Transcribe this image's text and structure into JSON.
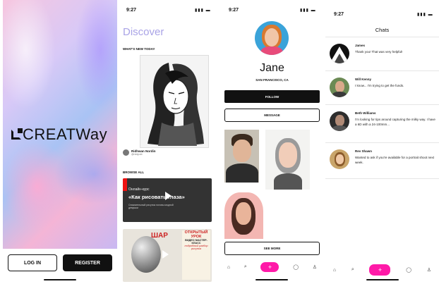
{
  "panel1": {
    "logo_text": "CREATWay",
    "login_label": "LOG IN",
    "register_label": "REGISTER"
  },
  "panel2": {
    "time": "9:27",
    "title": "Discover",
    "whats_new_label": "WHAT'S NEW TODAY",
    "author_name": "Ridhwan Nordin",
    "author_handle": "@ridzjcob",
    "browse_label": "BROWSE ALL",
    "card1": {
      "line1": "Онлайн-курс",
      "line2": "«Как рисовать глаза»",
      "line3": "Снимательный рисунок головы модной девушки"
    },
    "card2": {
      "shar": "ШАР",
      "side_title": "ОТКРЫТЫЙ УРОК",
      "side_sub": "ВИДЕО МАСТЕР-КЛАСС",
      "side_italic": "подробный разбор рисунка"
    }
  },
  "panel3": {
    "time": "9:27",
    "name": "Jane",
    "location": "SAN FRANCISCO, CA",
    "follow_label": "FOLLOW",
    "message_label": "MESSAGE",
    "see_more_label": "SEE MORE",
    "tabs": [
      "home-icon",
      "search-icon",
      "plus-icon",
      "chat-icon",
      "profile-icon"
    ]
  },
  "panel4": {
    "time": "9:27",
    "title": "Chats",
    "chats": [
      {
        "name": "James",
        "message": "Thank you! That was very helpful!"
      },
      {
        "name": "Will Kenny",
        "message": "I know... I'm trying to get the funds."
      },
      {
        "name": "Beth Williams",
        "message": "I'm looking for tips around capturing the milky way. I have a 6D with a 24-100mm..."
      },
      {
        "name": "Rev Shawn",
        "message": "Wanted to ask if you're available for a portrait shoot next week."
      }
    ]
  },
  "colors": {
    "accent_pink": "#ff1aa8",
    "discover_lavender": "#a9a3e6",
    "dark": "#111111"
  }
}
